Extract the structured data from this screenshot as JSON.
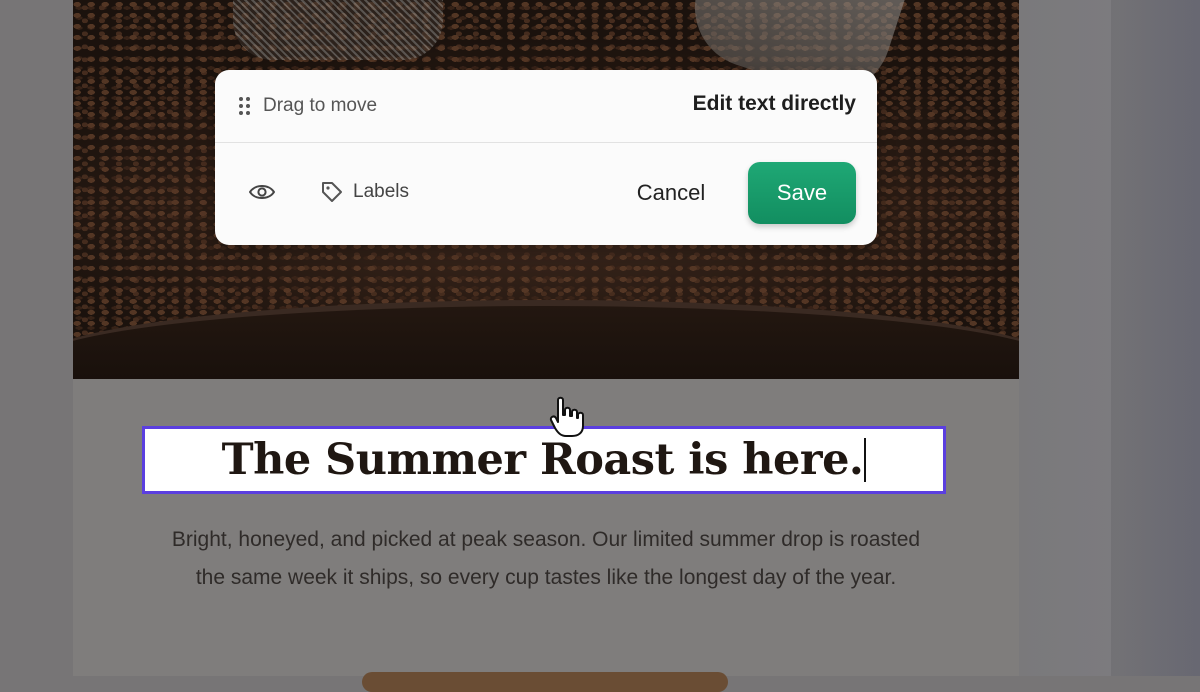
{
  "toolbar": {
    "drag_label": "Drag to move",
    "mode_label": "Edit text directly",
    "preview_icon": "eye-icon",
    "labels_icon": "tag-icon",
    "labels_label": "Labels",
    "cancel_label": "Cancel",
    "save_label": "Save",
    "save_color": "#17a06d"
  },
  "email": {
    "hero_image": "coffee beans in roaster",
    "headline": "The Summer Roast is here.",
    "body": "Bright, honeyed, and picked at peak season. Our limited summer drop is roasted the same week it ships, so every cup tastes like the longest day of the year.",
    "selection_color": "#5b3fe0"
  },
  "pointer": {
    "icon": "hand-pointer-icon"
  }
}
